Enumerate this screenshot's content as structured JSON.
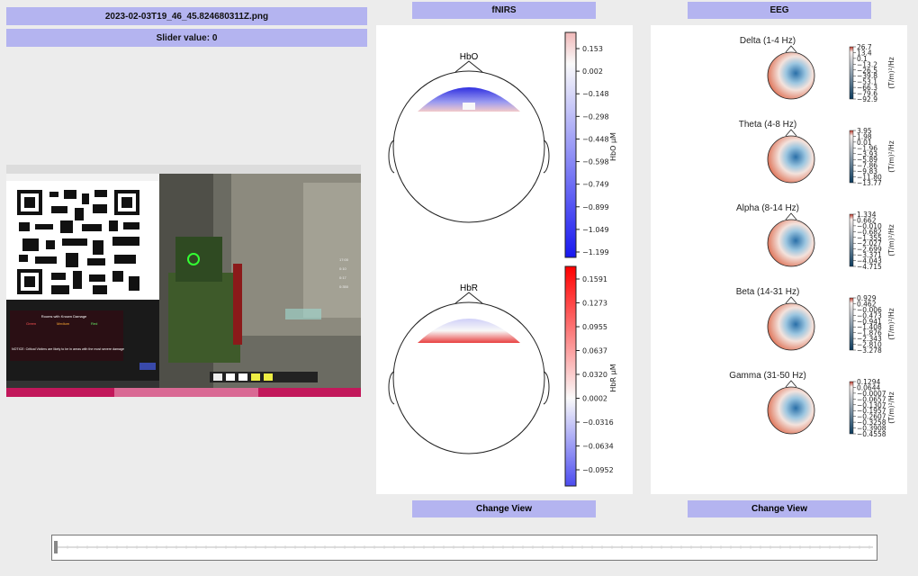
{
  "header": {
    "filename": "2023-02-03T19_46_45.824680311Z.png",
    "slider_label": "Slider value: 0"
  },
  "fnirs": {
    "title": "fNIRS",
    "hbo": {
      "title": "HbO",
      "unit": "HbO μM",
      "ticks": [
        "0.153",
        "0.002",
        "−0.148",
        "−0.298",
        "−0.448",
        "−0.598",
        "−0.749",
        "−0.899",
        "−1.049",
        "−1.199"
      ]
    },
    "hbr": {
      "title": "HbR",
      "unit": "HbR μM",
      "ticks": [
        "0.1591",
        "0.1273",
        "0.0955",
        "0.0637",
        "0.0320",
        "0.0002",
        "−0.0316",
        "−0.0634",
        "−0.0952"
      ]
    },
    "button": "Change View"
  },
  "eeg": {
    "title": "EEG",
    "unit": "(T/m)²/Hz",
    "bands": [
      {
        "name": "Delta (1-4 Hz)",
        "ticks": [
          "26.7",
          "13.4",
          "0.1",
          "−13.2",
          "−26.5",
          "−39.8",
          "−53.1",
          "−66.3",
          "−79.6",
          "−92.9"
        ]
      },
      {
        "name": "Theta (4-8 Hz)",
        "ticks": [
          "3.95",
          "1.98",
          "0.01",
          "−1.96",
          "−3.93",
          "−5.89",
          "−7.86",
          "−9.83",
          "−11.80",
          "−13.77"
        ]
      },
      {
        "name": "Alpha (8-14 Hz)",
        "ticks": [
          "1.334",
          "0.662",
          "−0.010",
          "−0.682",
          "−1.355",
          "−2.027",
          "−2.699",
          "−3.371",
          "−4.043",
          "−4.715"
        ]
      },
      {
        "name": "Beta (14-31 Hz)",
        "ticks": [
          "0.929",
          "0.462",
          "−0.006",
          "−0.473",
          "−0.941",
          "−1.408",
          "−1.876",
          "−2.343",
          "−2.810",
          "−3.278"
        ]
      },
      {
        "name": "Gamma (31-50 Hz)",
        "ticks": [
          "0.1294",
          "0.0644",
          "−0.0007",
          "−0.0657",
          "−0.1307",
          "−0.1957",
          "−0.2607",
          "−0.3258",
          "−0.3908",
          "−0.4558"
        ]
      }
    ],
    "button": "Change View"
  },
  "screenshot": {
    "popup_title": "Rooms with Known Damage",
    "col1": "Green",
    "col2": "Medium",
    "col3": "Red",
    "notice": "NOTICE: Critical Victims are likely to be in areas with the most severe damage",
    "hud": [
      "17:00",
      "0:10",
      "0:17",
      "0:350"
    ]
  }
}
